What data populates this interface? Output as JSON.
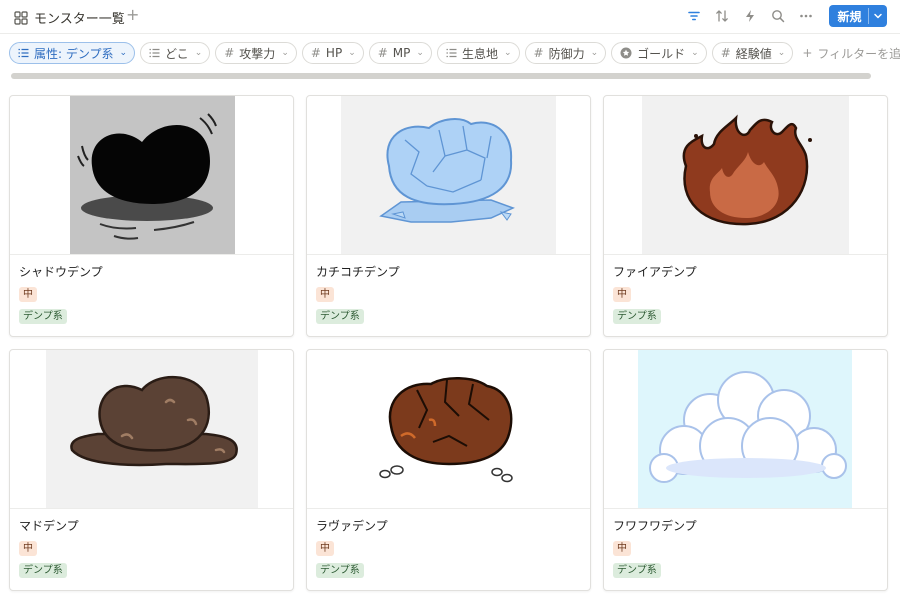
{
  "header": {
    "view_title": "モンスター一覧",
    "new_button": "新規",
    "view_icon": "gallery-grid-icon",
    "tool_icons": [
      "filter-icon",
      "sort-icon",
      "lightning-icon",
      "search-icon",
      "more-icon"
    ]
  },
  "filters": [
    {
      "label": "属性: デンプ系",
      "icon": "list-icon",
      "active": true
    },
    {
      "label": "どこ",
      "icon": "list-icon",
      "active": false
    },
    {
      "label": "攻撃力",
      "icon": "hash-icon",
      "active": false
    },
    {
      "label": "HP",
      "icon": "hash-icon",
      "active": false
    },
    {
      "label": "MP",
      "icon": "hash-icon",
      "active": false
    },
    {
      "label": "生息地",
      "icon": "list-icon",
      "active": false
    },
    {
      "label": "防御力",
      "icon": "hash-icon",
      "active": false
    },
    {
      "label": "ゴールド",
      "icon": "coin-icon",
      "active": false
    },
    {
      "label": "経験値",
      "icon": "hash-icon",
      "active": false
    }
  ],
  "add_filter": "フィルターを追",
  "colors": {
    "accent": "#2f80de",
    "size_tag_bg": "#fbe4d6",
    "type_tag_bg": "#dcecdd"
  },
  "cards": [
    {
      "name": "シャドウデンプ",
      "size": "中",
      "type": "デンプ系",
      "image": "shadow-blob-image",
      "bg": "#c4c4c4"
    },
    {
      "name": "カチコチデンプ",
      "size": "中",
      "type": "デンプ系",
      "image": "ice-blob-image",
      "bg": "#f1f1f1"
    },
    {
      "name": "ファイアデンプ",
      "size": "中",
      "type": "デンプ系",
      "image": "fire-blob-image",
      "bg": "#f1f1f1"
    },
    {
      "name": "マドデンプ",
      "size": "中",
      "type": "デンプ系",
      "image": "mud-blob-image",
      "bg": "#f1f1f1"
    },
    {
      "name": "ラヴァデンプ",
      "size": "中",
      "type": "デンプ系",
      "image": "lava-blob-image",
      "bg": "#ffffff"
    },
    {
      "name": "フワフワデンプ",
      "size": "中",
      "type": "デンプ系",
      "image": "cloud-blob-image",
      "bg": "#def6fc"
    }
  ]
}
